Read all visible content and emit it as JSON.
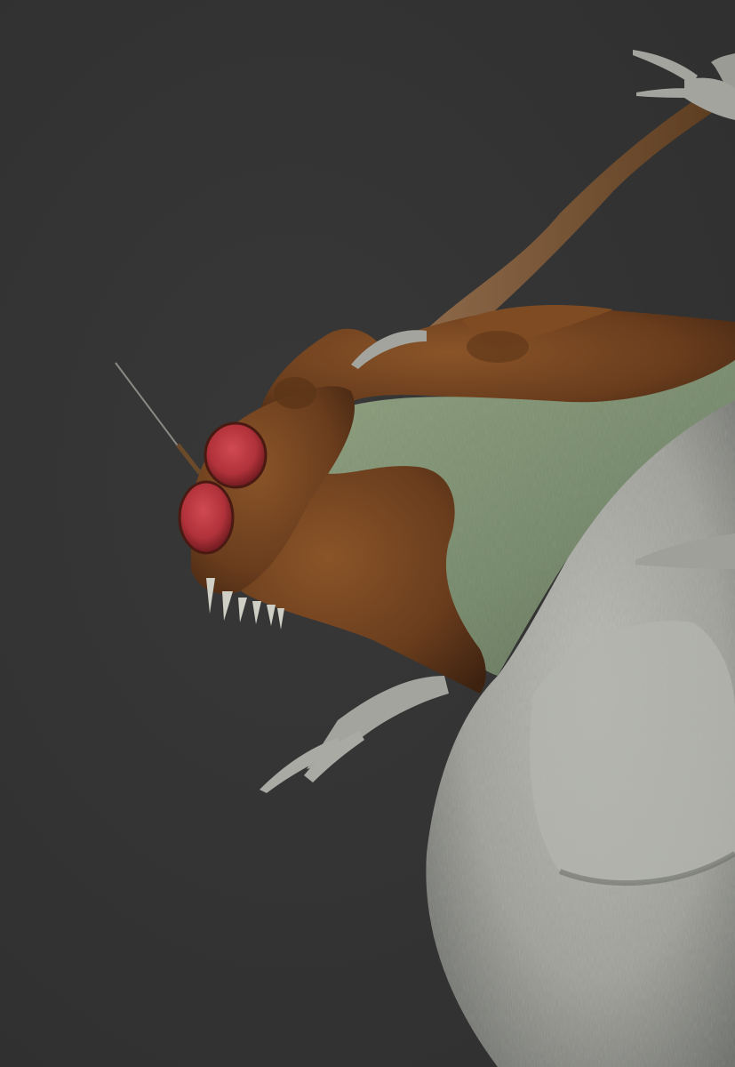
{
  "scene": {
    "subject": "creature-sculpt",
    "colors": {
      "background": "#333333",
      "clay": "#a8a9a3",
      "clay_shadow": "#6e706b",
      "moss": "#7f9271",
      "moss_dark": "#56654d",
      "hide_brown": "#6b3f1f",
      "hide_brown_dark": "#3f2410",
      "eye_red": "#b8363d",
      "eye_dark": "#6e1a20",
      "tooth": "#cfcfc6"
    }
  }
}
